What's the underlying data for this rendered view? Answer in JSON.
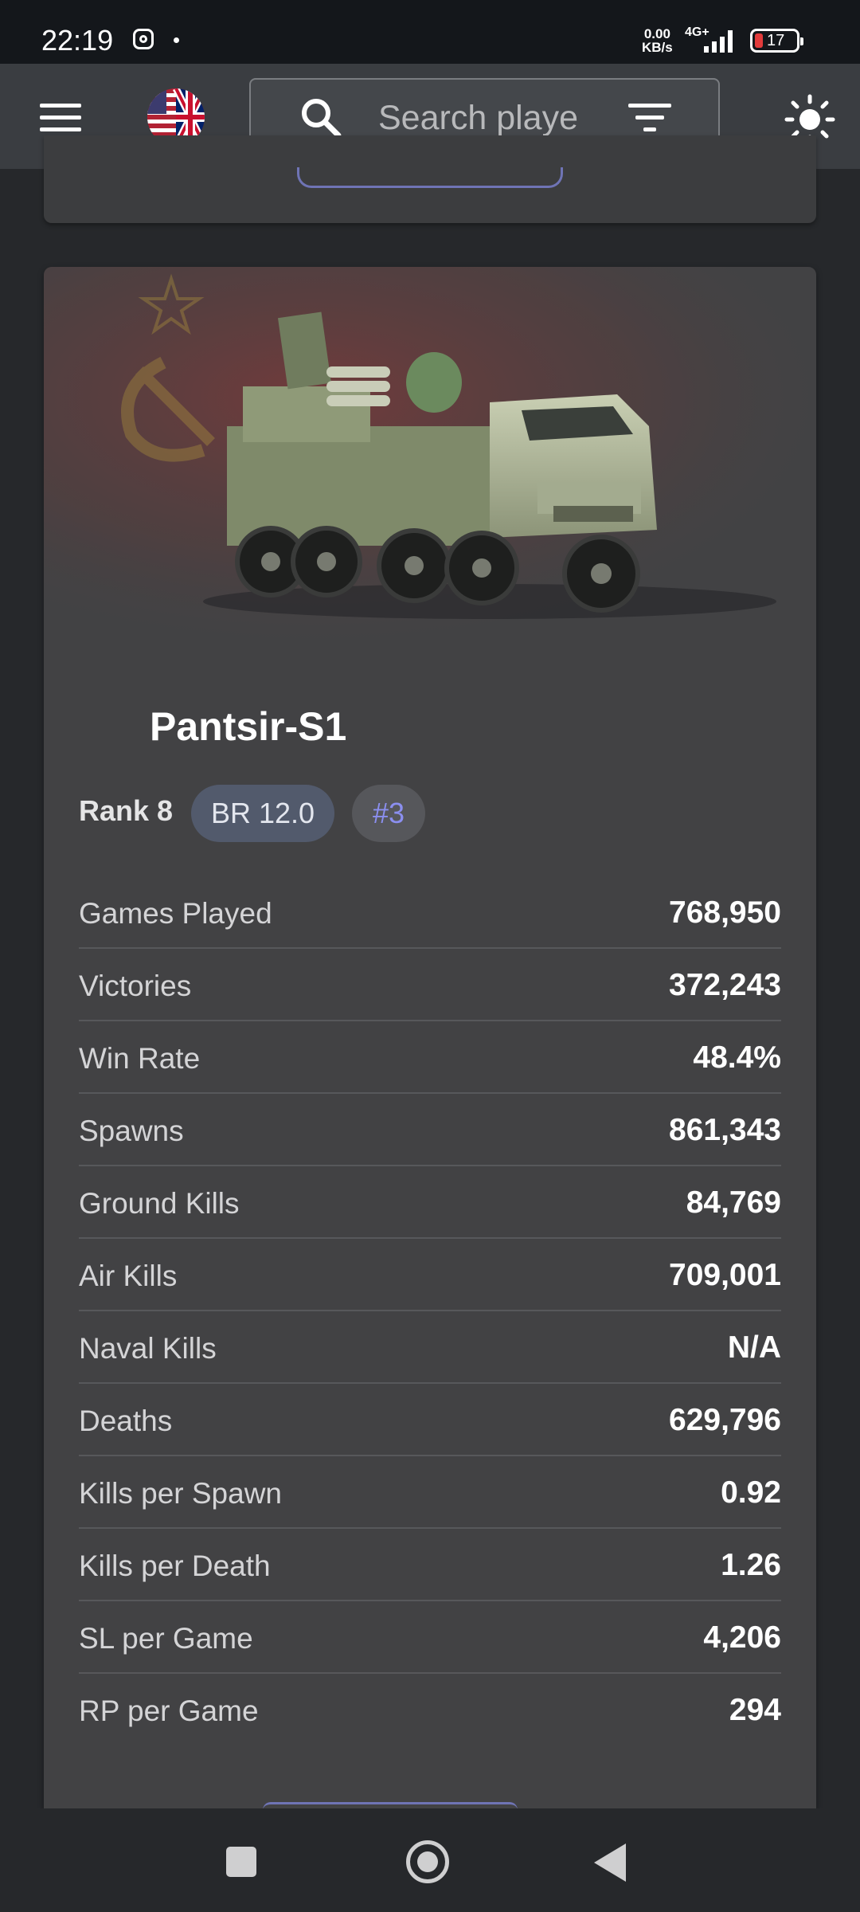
{
  "status_bar": {
    "time": "22:19",
    "net_speed_value": "0.00",
    "net_speed_unit": "KB/s",
    "network_type": "4G+",
    "battery_level": "17"
  },
  "app_bar": {
    "search_placeholder": "Search playe",
    "icons": [
      "menu-icon",
      "language-flag-icon",
      "search-icon",
      "filter-icon",
      "theme-toggle-sun-icon"
    ]
  },
  "vehicle": {
    "name": "Pantsir-S1",
    "rank": "Rank 8",
    "br": "BR 12.0",
    "rank_position": "#3",
    "nation_flag": "USSR",
    "stats": [
      {
        "label": "Games Played",
        "value": "768,950"
      },
      {
        "label": "Victories",
        "value": "372,243"
      },
      {
        "label": "Win Rate",
        "value": "48.4%"
      },
      {
        "label": "Spawns",
        "value": "861,343"
      },
      {
        "label": "Ground Kills",
        "value": "84,769"
      },
      {
        "label": "Air Kills",
        "value": "709,001"
      },
      {
        "label": "Naval Kills",
        "value": "N/A"
      },
      {
        "label": "Deaths",
        "value": "629,796"
      },
      {
        "label": "Kills per Spawn",
        "value": "0.92"
      },
      {
        "label": "Kills per Death",
        "value": "1.26"
      },
      {
        "label": "SL per Game",
        "value": "4,206"
      },
      {
        "label": "RP per Game",
        "value": "294"
      }
    ]
  },
  "colors": {
    "app_bar": "#3a3d41",
    "card": "#424244",
    "accent": "#8b8ff0",
    "br_chip": "#525a6c"
  }
}
